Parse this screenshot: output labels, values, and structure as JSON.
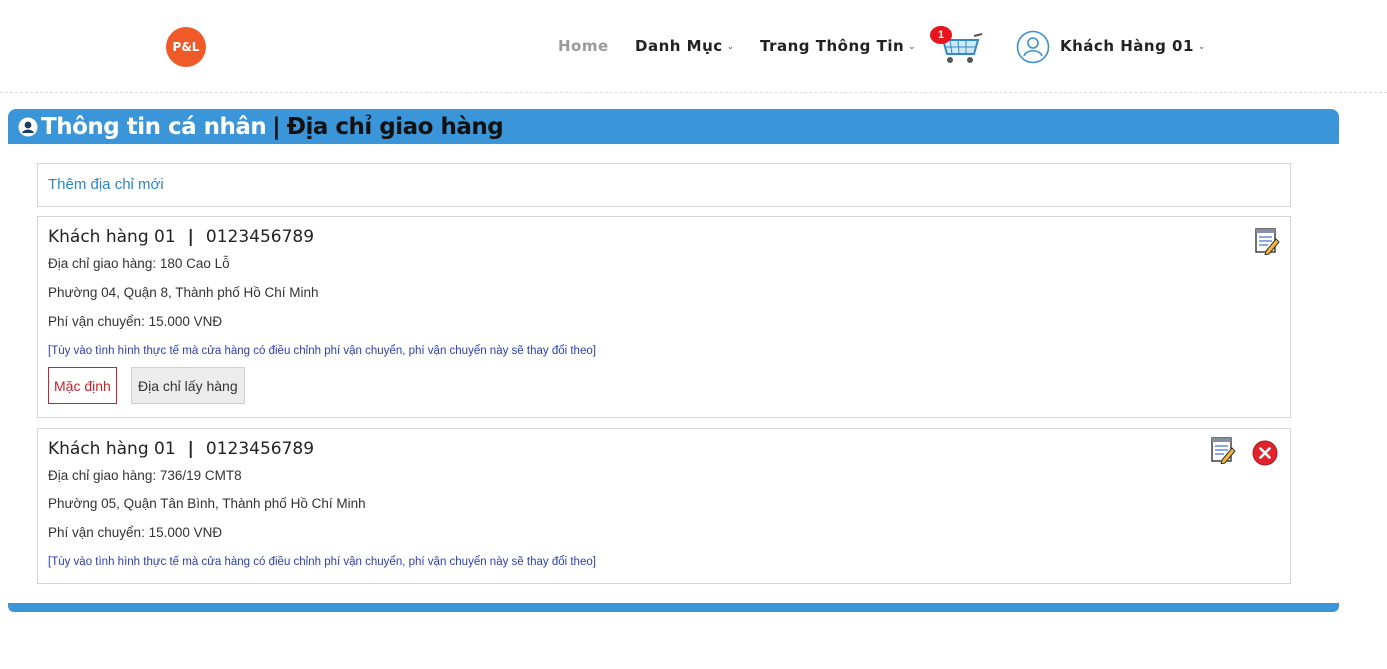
{
  "header": {
    "logo_text": "P&L",
    "nav": {
      "home": "Home",
      "danh_muc": "Danh Mục",
      "trang_thong_tin": "Trang Thông Tin"
    },
    "cart_count": "1",
    "user_name": "Khách Hàng 01"
  },
  "section": {
    "title": "Thông tin cá nhân",
    "separator": "|",
    "subtitle": "Địa chỉ giao hàng"
  },
  "add_address_label": "Thêm địa chỉ mới",
  "addresses": [
    {
      "name": "Khách hàng 01",
      "phone": "0123456789",
      "street": "Địa chỉ giao hàng: 180 Cao Lỗ",
      "region": "Phường 04, Quận 8, Thành phố Hồ Chí Minh",
      "fee": "Phí vận chuyển: 15.000 VNĐ",
      "note": "[Tùy vào tình hình thực tế mà cửa hàng có điều chỉnh phí vận chuyển, phí vận chuyển này sẽ thay đổi theo]",
      "default_label": "Mặc định",
      "pickup_label": "Địa chỉ lấy hàng"
    },
    {
      "name": "Khách hàng 01",
      "phone": "0123456789",
      "street": "Địa chỉ giao hàng: 736/19 CMT8",
      "region": "Phường 05, Quận Tân Bình, Thành phố Hồ Chí Minh",
      "fee": "Phí vận chuyển: 15.000 VNĐ",
      "note": "[Tùy vào tình hình thực tế mà cửa hàng có điều chỉnh phí vận chuyển, phí vận chuyển này sẽ thay đổi theo]"
    }
  ],
  "colors": {
    "accent": "#3a96d8",
    "logo": "#f05a28",
    "danger": "#c9242b",
    "note": "#2a3dbd",
    "link": "#2a86c8"
  },
  "icons": {
    "cart": "shopping-cart-icon",
    "user": "user-circle-icon",
    "edit": "edit-note-icon",
    "delete": "close-circle-icon"
  }
}
